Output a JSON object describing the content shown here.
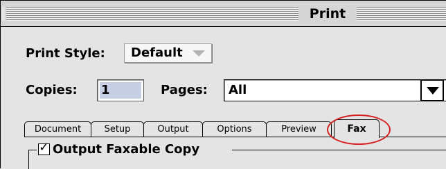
{
  "window": {
    "title": "Print"
  },
  "print_style": {
    "label": "Print Style:",
    "value": "Default"
  },
  "copies": {
    "label": "Copies:",
    "value": "1"
  },
  "pages": {
    "label": "Pages:",
    "value": "All"
  },
  "tabs": [
    {
      "label": "Document",
      "selected": false
    },
    {
      "label": "Setup",
      "selected": false
    },
    {
      "label": "Output",
      "selected": false
    },
    {
      "label": "Options",
      "selected": false
    },
    {
      "label": "Preview",
      "selected": false
    },
    {
      "label": "Fax",
      "selected": true
    }
  ],
  "fax_group": {
    "checkbox_label": "Output Faxable Copy",
    "checked": true
  },
  "colors": {
    "annotation": "#d42020",
    "selection": "#c7cfe4"
  }
}
